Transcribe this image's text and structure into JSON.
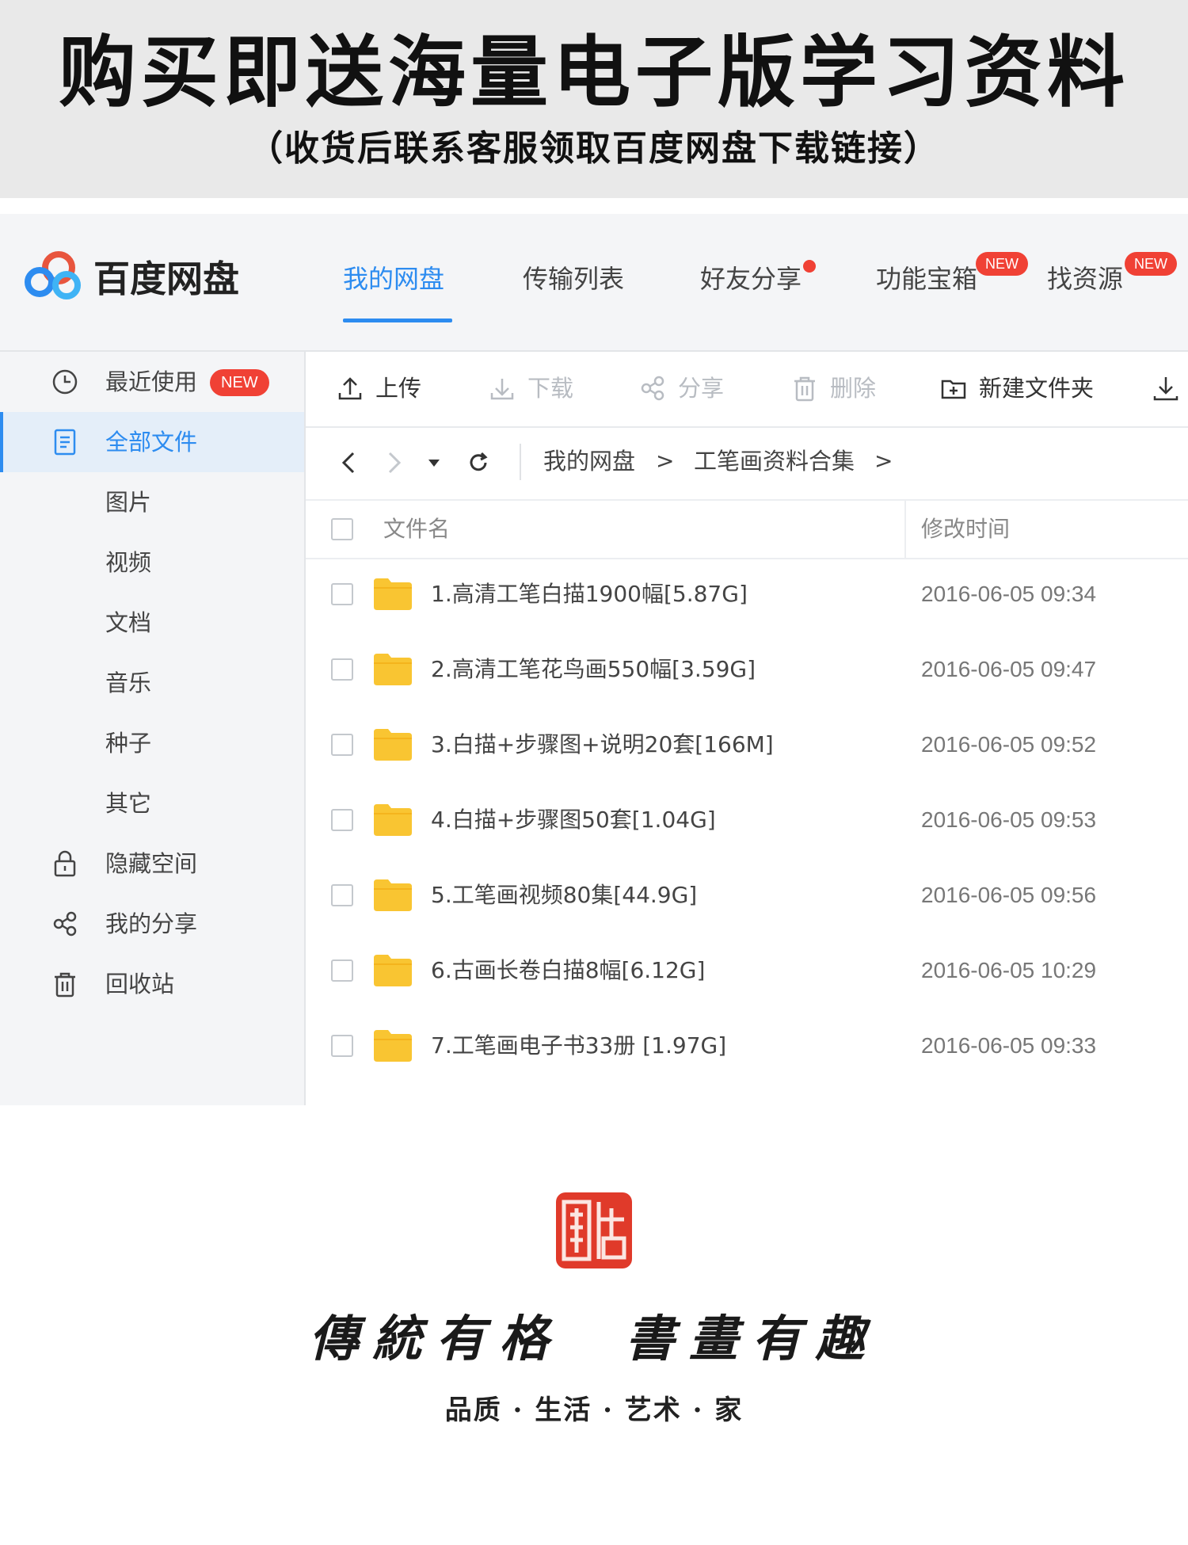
{
  "banner": {
    "title": "购买即送海量电子版学习资料",
    "subtitle": "（收货后联系客服领取百度网盘下载链接）"
  },
  "app": {
    "name": "百度网盘",
    "accent_color": "#2d8cf0",
    "badge_color": "#f04135",
    "nav": {
      "tabs": [
        {
          "label": "我的网盘",
          "active": true
        },
        {
          "label": "传输列表",
          "active": false
        },
        {
          "label": "好友分享",
          "active": false,
          "dot": true
        },
        {
          "label": "功能宝箱",
          "active": false,
          "badge": "NEW"
        },
        {
          "label": "找资源",
          "active": false,
          "badge": "NEW"
        }
      ]
    },
    "sidebar": {
      "items": [
        {
          "label": "最近使用",
          "icon": "clock-icon",
          "badge": "NEW"
        },
        {
          "label": "全部文件",
          "icon": "document-icon",
          "active": true
        },
        {
          "label": "图片"
        },
        {
          "label": "视频"
        },
        {
          "label": "文档"
        },
        {
          "label": "音乐"
        },
        {
          "label": "种子"
        },
        {
          "label": "其它"
        },
        {
          "label": "隐藏空间",
          "icon": "lock-icon"
        },
        {
          "label": "我的分享",
          "icon": "share-icon"
        },
        {
          "label": "回收站",
          "icon": "trash-icon"
        }
      ]
    },
    "toolbar": {
      "upload": "上传",
      "download": "下载",
      "share": "分享",
      "delete": "删除",
      "new_folder": "新建文件夹"
    },
    "breadcrumb": {
      "root": "我的网盘",
      "current": "工笔画资料合集",
      "separator": ">"
    },
    "columns": {
      "name": "文件名",
      "modified": "修改时间"
    },
    "files": [
      {
        "name": "1.高清工笔白描1900幅[5.87G]",
        "time": "2016-06-05 09:34"
      },
      {
        "name": "2.高清工笔花鸟画550幅[3.59G]",
        "time": "2016-06-05 09:47"
      },
      {
        "name": "3.白描+步骤图+说明20套[166M]",
        "time": "2016-06-05 09:52"
      },
      {
        "name": "4.白描+步骤图50套[1.04G]",
        "time": "2016-06-05 09:53"
      },
      {
        "name": "5.工笔画视频80集[44.9G]",
        "time": "2016-06-05 09:56"
      },
      {
        "name": "6.古画长卷白描8幅[6.12G]",
        "time": "2016-06-05 10:29"
      },
      {
        "name": "7.工笔画电子书33册 [1.97G]",
        "time": "2016-06-05 09:33"
      }
    ]
  },
  "footer": {
    "seal_color": "#e03a2a",
    "slogan": "傳統有格  書畫有趣",
    "tagline": "品质 · 生活 · 艺术 · 家"
  }
}
